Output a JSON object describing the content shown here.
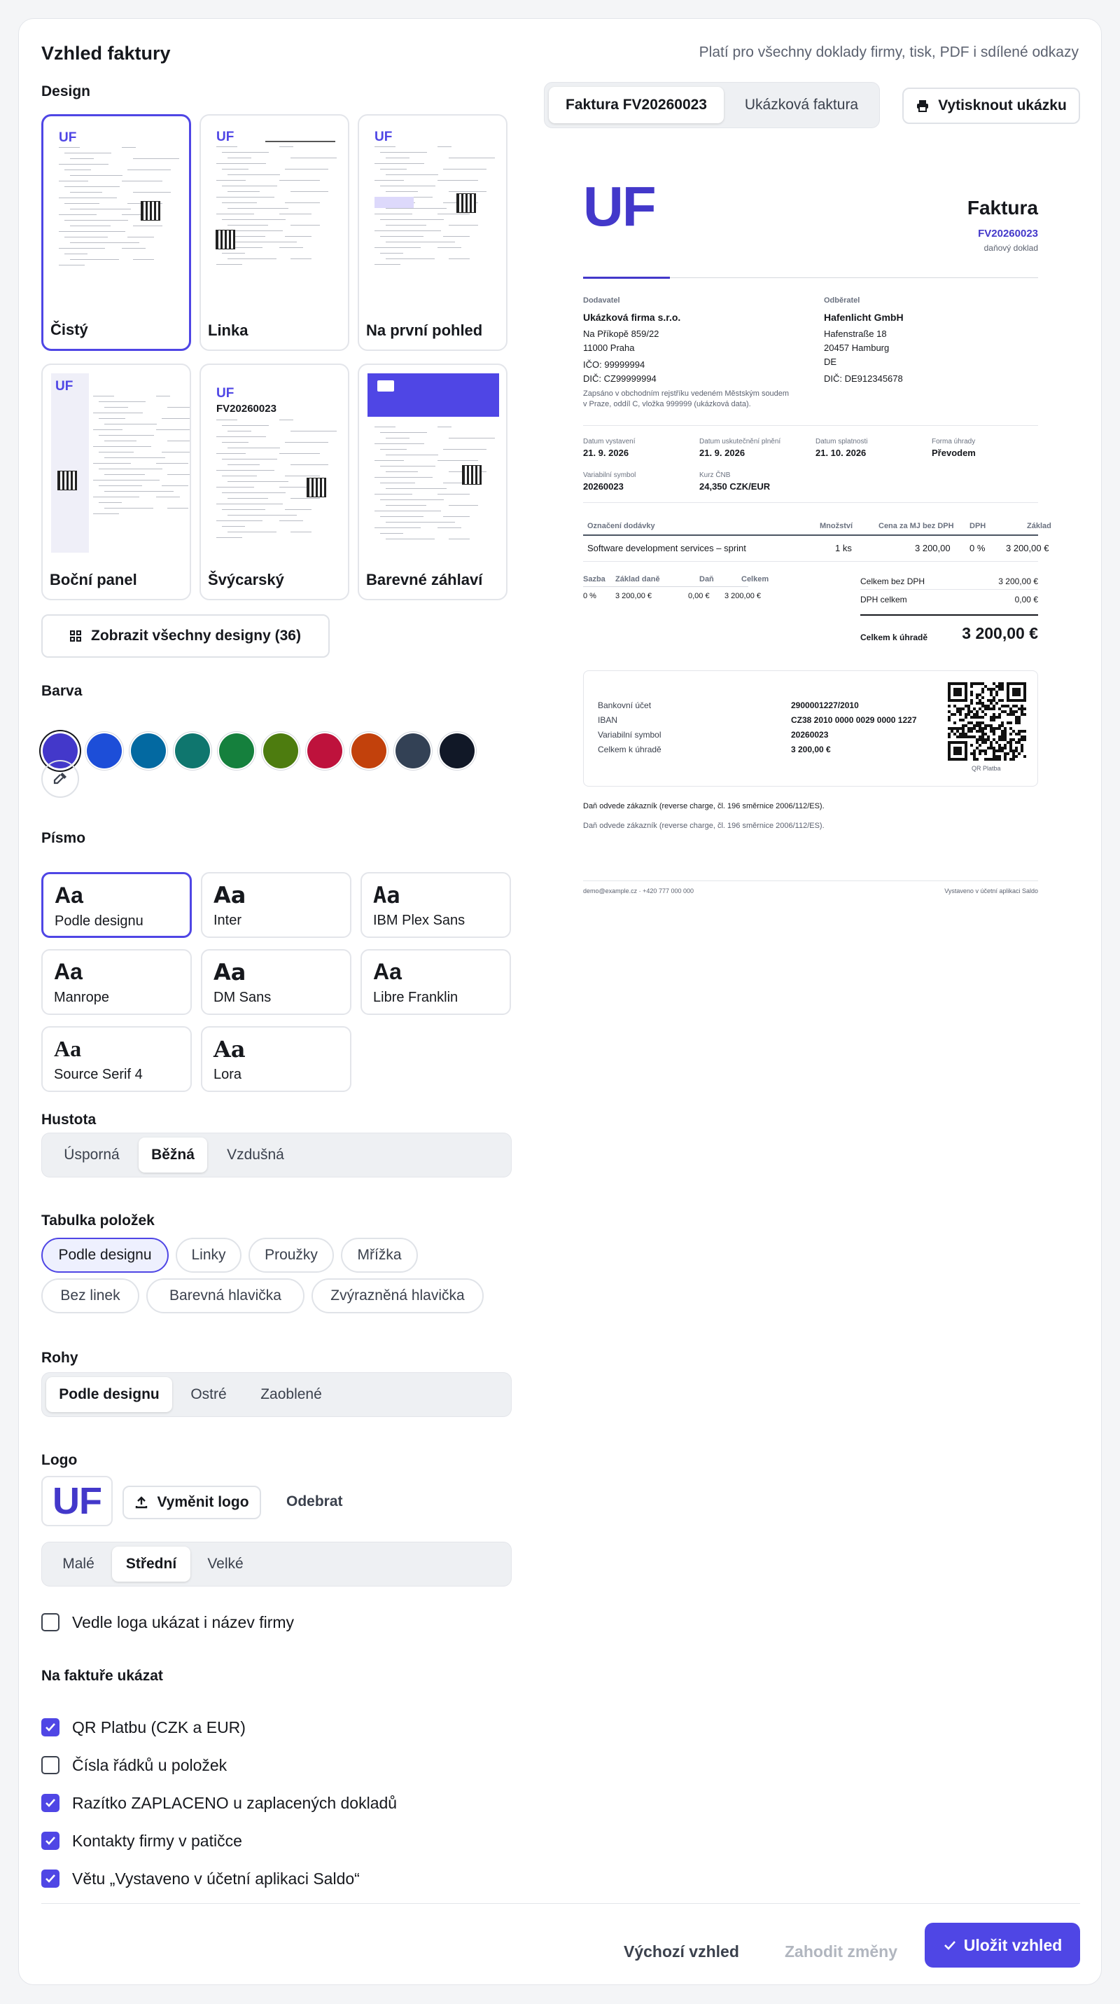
{
  "header": {
    "title": "Vzhled faktury",
    "subtitle": "Platí pro všechny doklady firmy, tisk, PDF i sdílené odkazy"
  },
  "design": {
    "label": "Design",
    "tiles": [
      "Čistý",
      "Linka",
      "Na první pohled",
      "Boční panel",
      "Švýcarský",
      "Barevné záhlaví"
    ],
    "selected": "Čistý",
    "show_all": "Zobrazit všechny designy (36)"
  },
  "color": {
    "label": "Barva",
    "swatches": [
      "#4338ca",
      "#1d4ed8",
      "#0369a1",
      "#0f766e",
      "#15803d",
      "#4d7c0f",
      "#be123c",
      "#c2410c",
      "#334155",
      "#111827"
    ],
    "selected": "#4338ca",
    "picker_icon": "eyedropper-icon"
  },
  "font": {
    "label": "Písmo",
    "aa": "Aa",
    "options": [
      "Podle designu",
      "Inter",
      "IBM Plex Sans",
      "Manrope",
      "DM Sans",
      "Libre Franklin",
      "Source Serif 4",
      "Lora"
    ],
    "selected": "Podle designu"
  },
  "density": {
    "label": "Hustota",
    "options": [
      "Úsporná",
      "Běžná",
      "Vzdušná"
    ],
    "selected": "Běžná"
  },
  "table": {
    "label": "Tabulka položek",
    "options": [
      "Podle designu",
      "Linky",
      "Proužky",
      "Mřížka",
      "Bez linek",
      "Barevná hlavička",
      "Zvýrazněná hlavička"
    ],
    "selected": "Podle designu"
  },
  "corners": {
    "label": "Rohy",
    "options": [
      "Podle designu",
      "Ostré",
      "Zaoblené"
    ],
    "selected": "Podle designu"
  },
  "logo": {
    "label": "Logo",
    "mark": "UF",
    "replace": "Vyměnit logo",
    "remove": "Odebrat",
    "sizes": [
      "Malé",
      "Střední",
      "Velké"
    ],
    "selected": "Střední",
    "show_name": "Vedle loga ukázat i název firmy",
    "show_name_checked": false
  },
  "show": {
    "label": "Na faktuře ukázat",
    "items": [
      {
        "label": "QR Platbu (CZK a EUR)",
        "checked": true
      },
      {
        "label": "Čísla řádků u položek",
        "checked": false
      },
      {
        "label": "Razítko ZAPLACENO u zaplacených dokladů",
        "checked": true
      },
      {
        "label": "Kontakty firmy v patičce",
        "checked": true
      },
      {
        "label": "Větu „Vystaveno v účetní aplikaci Saldo“",
        "checked": true
      }
    ]
  },
  "footer": {
    "default": "Výchozí vzhled",
    "discard": "Zahodit změny",
    "save": "Uložit vzhled"
  },
  "preview": {
    "tabs": [
      "Faktura FV20260023",
      "Ukázková faktura"
    ],
    "active_tab": "Faktura FV20260023",
    "print": "Vytisknout ukázku"
  },
  "invoice": {
    "logo": "UF",
    "title": "Faktura",
    "number": "FV20260023",
    "doc_type": "daňový doklad",
    "supplier_label": "Dodavatel",
    "supplier_name": "Ukázková firma s.r.o.",
    "supplier_street": "Na Příkopě 859/22",
    "supplier_city": "11000 Praha",
    "supplier_ico": "IČO: 99999994",
    "supplier_dic": "DIČ: CZ99999994",
    "supplier_note": "Zapsáno v obchodním rejstříku vedeném Městským soudem v Praze, oddíl C, vložka 999999 (ukázková data).",
    "customer_label": "Odběratel",
    "customer_name": "Hafenlicht GmbH",
    "customer_street": "Hafenstraße 18",
    "customer_city": "20457 Hamburg",
    "customer_country": "DE",
    "customer_dic": "DIČ: DE912345678",
    "meta": [
      {
        "label": "Datum vystavení",
        "value": "21. 9. 2026"
      },
      {
        "label": "Datum uskutečnění plnění",
        "value": "21. 9. 2026"
      },
      {
        "label": "Datum splatnosti",
        "value": "21. 10. 2026"
      },
      {
        "label": "Forma úhrady",
        "value": "Převodem"
      },
      {
        "label": "Variabilní symbol",
        "value": "20260023"
      },
      {
        "label": "Kurz ČNB",
        "value": "24,350 CZK/EUR"
      }
    ],
    "cols": [
      "Označení dodávky",
      "Množství",
      "Cena za MJ bez DPH",
      "DPH",
      "Základ"
    ],
    "row": [
      "Software development services – sprint",
      "1 ks",
      "3 200,00",
      "0 %",
      "3 200,00 €"
    ],
    "vat_cols": [
      "Sazba",
      "Základ daně",
      "Daň",
      "Celkem"
    ],
    "vat_row": [
      "0 %",
      "3 200,00 €",
      "0,00 €",
      "3 200,00 €"
    ],
    "sum_label_1": "Celkem bez DPH",
    "sum_value_1": "3 200,00 €",
    "sum_label_2": "DPH celkem",
    "sum_value_2": "0,00 €",
    "total_label": "Celkem k úhradě",
    "total_value": "3 200,00 €",
    "pay": [
      {
        "label": "Bankovní účet",
        "value": "2900001227/2010"
      },
      {
        "label": "IBAN",
        "value": "CZ38 2010 0000 0029 0000 1227"
      },
      {
        "label": "Variabilní symbol",
        "value": "20260023"
      },
      {
        "label": "Celkem k úhradě",
        "value": "3 200,00 €"
      }
    ],
    "qr_label": "QR Platba",
    "note_1": "Daň odvede zákazník (reverse charge, čl. 196 směrnice 2006/112/ES).",
    "note_2": "Daň odvede zákazník (reverse charge, čl. 196 směrnice 2006/112/ES).",
    "footer_left": "demo@example.cz · +420 777 000 000",
    "footer_right": "Vystaveno v účetní aplikaci Saldo"
  }
}
